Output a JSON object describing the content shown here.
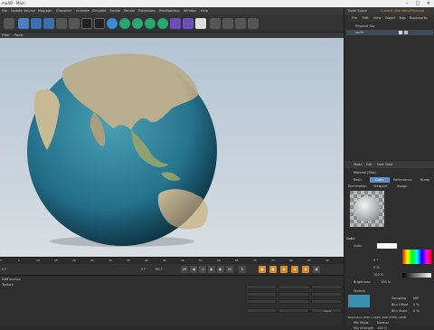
{
  "window": {
    "title": "ma4D - Main"
  },
  "menubar": {
    "items": [
      "File",
      "Update",
      "Volume",
      "Mograph",
      "Character",
      "Animate",
      "Simulate",
      "Tracker",
      "Render",
      "Extensions",
      "Realflow/Imp",
      "Window",
      "Help"
    ]
  },
  "viewport_header": {
    "filter": "Filter",
    "panel": "Panel"
  },
  "object_manager": {
    "menu": [
      "Node Space",
      "Current (Standard/Physical)"
    ],
    "tabs": [
      "File",
      "Edit",
      "View",
      "Object",
      "Tags",
      "Bookmarks"
    ],
    "objects": [
      {
        "name": "Physical Sky"
      },
      {
        "name": "earth"
      }
    ]
  },
  "attribute_manager": {
    "menu": [
      "Mode",
      "Edit",
      "User Data"
    ],
    "material_title": "Material [Mat]",
    "tabs": [
      "Basic",
      "Color",
      "Reflectance",
      "Bump"
    ],
    "tabs2": [
      "Illumination",
      "Viewport",
      "Assign"
    ],
    "section": "Color",
    "color_label": "Color",
    "h_value": "0 °",
    "s_value": "0 %",
    "v_value": "100 %",
    "brightness_label": "Brightness",
    "brightness_value": "100 %",
    "texture_label": "Texture",
    "sampling_label": "Sampling",
    "sampling_value": "MIP",
    "blur_offset_label": "Blur Offset",
    "blur_offset_value": "0 %",
    "blur_scale_label": "Blur Scale",
    "blur_scale_value": "0 %",
    "resolution_text": "Resolution 4320 x 2160, RGB (8 Bit), sRGB",
    "mix_mode_label": "Mix Mode",
    "mix_mode_value": "Normal",
    "mix_strength_label": "Mix Strength",
    "mix_strength_value": "100 %"
  },
  "timeline": {
    "ticks": [
      "0",
      "5",
      "10",
      "15",
      "20",
      "25",
      "30",
      "35",
      "40",
      "45",
      "50",
      "55",
      "60",
      "65",
      "70",
      "75",
      "80",
      "85",
      "90"
    ],
    "current_frame": "0 F",
    "start_frame": "0 F",
    "end_frame": "90 F",
    "fps": "90 F"
  },
  "bottom_panel": {
    "tabs": [
      "Edit",
      "Function",
      "Texture"
    ],
    "apply_label": "Apply"
  },
  "colors": {
    "accent_orange": "#d58a2b",
    "selected_tab": "#5b8fd0",
    "panel_bg": "#2e2e2e"
  }
}
